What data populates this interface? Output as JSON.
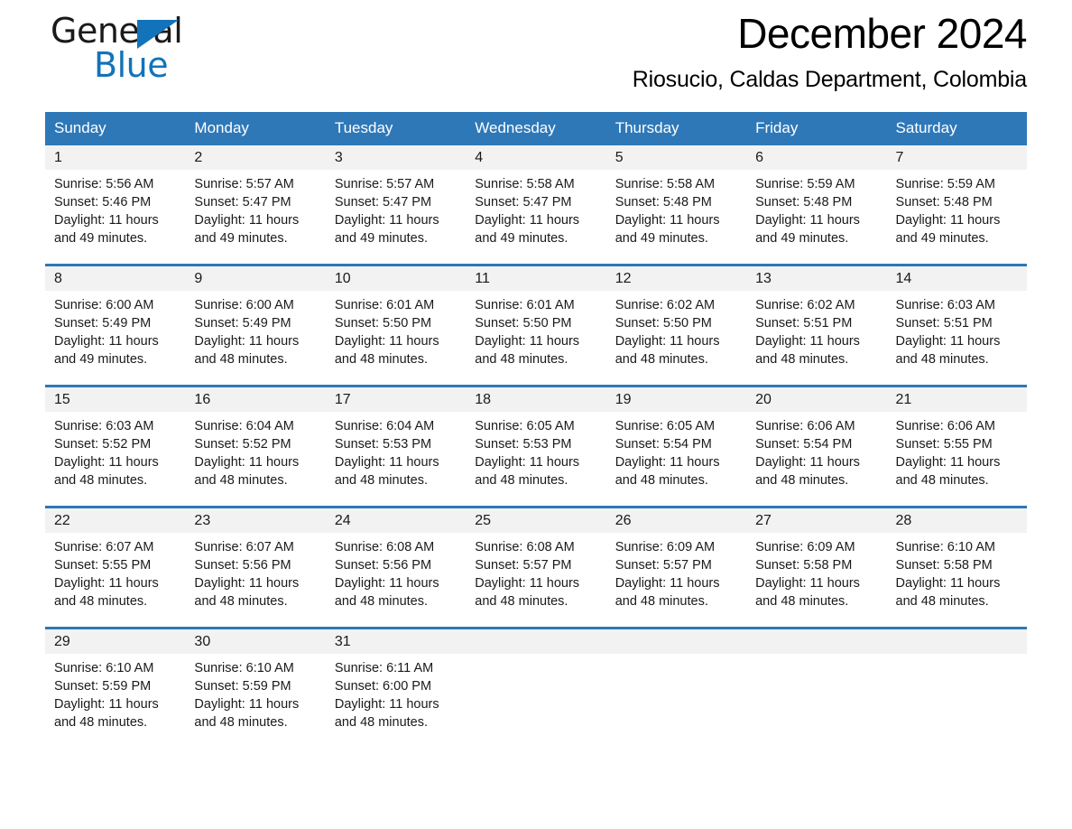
{
  "brand": {
    "logo_text_primary": "General",
    "logo_text_secondary": "Blue",
    "accent_color": "#1273ba",
    "header_color": "#2e78b8"
  },
  "header": {
    "month_title": "December 2024",
    "location": "Riosucio, Caldas Department, Colombia"
  },
  "weekday_headers": [
    "Sunday",
    "Monday",
    "Tuesday",
    "Wednesday",
    "Thursday",
    "Friday",
    "Saturday"
  ],
  "weeks": [
    [
      {
        "day": "1",
        "sunrise": "Sunrise: 5:56 AM",
        "sunset": "Sunset: 5:46 PM",
        "daylight": "Daylight: 11 hours and 49 minutes."
      },
      {
        "day": "2",
        "sunrise": "Sunrise: 5:57 AM",
        "sunset": "Sunset: 5:47 PM",
        "daylight": "Daylight: 11 hours and 49 minutes."
      },
      {
        "day": "3",
        "sunrise": "Sunrise: 5:57 AM",
        "sunset": "Sunset: 5:47 PM",
        "daylight": "Daylight: 11 hours and 49 minutes."
      },
      {
        "day": "4",
        "sunrise": "Sunrise: 5:58 AM",
        "sunset": "Sunset: 5:47 PM",
        "daylight": "Daylight: 11 hours and 49 minutes."
      },
      {
        "day": "5",
        "sunrise": "Sunrise: 5:58 AM",
        "sunset": "Sunset: 5:48 PM",
        "daylight": "Daylight: 11 hours and 49 minutes."
      },
      {
        "day": "6",
        "sunrise": "Sunrise: 5:59 AM",
        "sunset": "Sunset: 5:48 PM",
        "daylight": "Daylight: 11 hours and 49 minutes."
      },
      {
        "day": "7",
        "sunrise": "Sunrise: 5:59 AM",
        "sunset": "Sunset: 5:48 PM",
        "daylight": "Daylight: 11 hours and 49 minutes."
      }
    ],
    [
      {
        "day": "8",
        "sunrise": "Sunrise: 6:00 AM",
        "sunset": "Sunset: 5:49 PM",
        "daylight": "Daylight: 11 hours and 49 minutes."
      },
      {
        "day": "9",
        "sunrise": "Sunrise: 6:00 AM",
        "sunset": "Sunset: 5:49 PM",
        "daylight": "Daylight: 11 hours and 48 minutes."
      },
      {
        "day": "10",
        "sunrise": "Sunrise: 6:01 AM",
        "sunset": "Sunset: 5:50 PM",
        "daylight": "Daylight: 11 hours and 48 minutes."
      },
      {
        "day": "11",
        "sunrise": "Sunrise: 6:01 AM",
        "sunset": "Sunset: 5:50 PM",
        "daylight": "Daylight: 11 hours and 48 minutes."
      },
      {
        "day": "12",
        "sunrise": "Sunrise: 6:02 AM",
        "sunset": "Sunset: 5:50 PM",
        "daylight": "Daylight: 11 hours and 48 minutes."
      },
      {
        "day": "13",
        "sunrise": "Sunrise: 6:02 AM",
        "sunset": "Sunset: 5:51 PM",
        "daylight": "Daylight: 11 hours and 48 minutes."
      },
      {
        "day": "14",
        "sunrise": "Sunrise: 6:03 AM",
        "sunset": "Sunset: 5:51 PM",
        "daylight": "Daylight: 11 hours and 48 minutes."
      }
    ],
    [
      {
        "day": "15",
        "sunrise": "Sunrise: 6:03 AM",
        "sunset": "Sunset: 5:52 PM",
        "daylight": "Daylight: 11 hours and 48 minutes."
      },
      {
        "day": "16",
        "sunrise": "Sunrise: 6:04 AM",
        "sunset": "Sunset: 5:52 PM",
        "daylight": "Daylight: 11 hours and 48 minutes."
      },
      {
        "day": "17",
        "sunrise": "Sunrise: 6:04 AM",
        "sunset": "Sunset: 5:53 PM",
        "daylight": "Daylight: 11 hours and 48 minutes."
      },
      {
        "day": "18",
        "sunrise": "Sunrise: 6:05 AM",
        "sunset": "Sunset: 5:53 PM",
        "daylight": "Daylight: 11 hours and 48 minutes."
      },
      {
        "day": "19",
        "sunrise": "Sunrise: 6:05 AM",
        "sunset": "Sunset: 5:54 PM",
        "daylight": "Daylight: 11 hours and 48 minutes."
      },
      {
        "day": "20",
        "sunrise": "Sunrise: 6:06 AM",
        "sunset": "Sunset: 5:54 PM",
        "daylight": "Daylight: 11 hours and 48 minutes."
      },
      {
        "day": "21",
        "sunrise": "Sunrise: 6:06 AM",
        "sunset": "Sunset: 5:55 PM",
        "daylight": "Daylight: 11 hours and 48 minutes."
      }
    ],
    [
      {
        "day": "22",
        "sunrise": "Sunrise: 6:07 AM",
        "sunset": "Sunset: 5:55 PM",
        "daylight": "Daylight: 11 hours and 48 minutes."
      },
      {
        "day": "23",
        "sunrise": "Sunrise: 6:07 AM",
        "sunset": "Sunset: 5:56 PM",
        "daylight": "Daylight: 11 hours and 48 minutes."
      },
      {
        "day": "24",
        "sunrise": "Sunrise: 6:08 AM",
        "sunset": "Sunset: 5:56 PM",
        "daylight": "Daylight: 11 hours and 48 minutes."
      },
      {
        "day": "25",
        "sunrise": "Sunrise: 6:08 AM",
        "sunset": "Sunset: 5:57 PM",
        "daylight": "Daylight: 11 hours and 48 minutes."
      },
      {
        "day": "26",
        "sunrise": "Sunrise: 6:09 AM",
        "sunset": "Sunset: 5:57 PM",
        "daylight": "Daylight: 11 hours and 48 minutes."
      },
      {
        "day": "27",
        "sunrise": "Sunrise: 6:09 AM",
        "sunset": "Sunset: 5:58 PM",
        "daylight": "Daylight: 11 hours and 48 minutes."
      },
      {
        "day": "28",
        "sunrise": "Sunrise: 6:10 AM",
        "sunset": "Sunset: 5:58 PM",
        "daylight": "Daylight: 11 hours and 48 minutes."
      }
    ],
    [
      {
        "day": "29",
        "sunrise": "Sunrise: 6:10 AM",
        "sunset": "Sunset: 5:59 PM",
        "daylight": "Daylight: 11 hours and 48 minutes."
      },
      {
        "day": "30",
        "sunrise": "Sunrise: 6:10 AM",
        "sunset": "Sunset: 5:59 PM",
        "daylight": "Daylight: 11 hours and 48 minutes."
      },
      {
        "day": "31",
        "sunrise": "Sunrise: 6:11 AM",
        "sunset": "Sunset: 6:00 PM",
        "daylight": "Daylight: 11 hours and 48 minutes."
      },
      {
        "day": "",
        "sunrise": "",
        "sunset": "",
        "daylight": ""
      },
      {
        "day": "",
        "sunrise": "",
        "sunset": "",
        "daylight": ""
      },
      {
        "day": "",
        "sunrise": "",
        "sunset": "",
        "daylight": ""
      },
      {
        "day": "",
        "sunrise": "",
        "sunset": "",
        "daylight": ""
      }
    ]
  ]
}
